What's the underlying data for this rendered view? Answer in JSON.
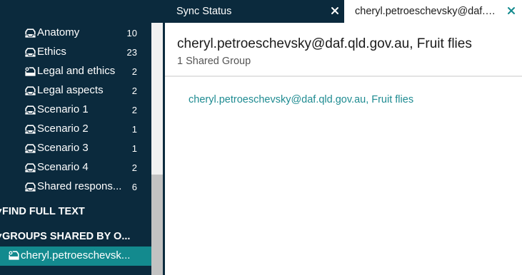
{
  "tabs": [
    {
      "label": "Sync Status"
    },
    {
      "label": "cheryl.petroeschevsky@daf.qld.gov.au, Fruit flies"
    }
  ],
  "sidebar": {
    "groups": [
      {
        "label": "Anatomy",
        "count": "10",
        "icon": "group-icon"
      },
      {
        "label": "Ethics",
        "count": "23",
        "icon": "group-icon"
      },
      {
        "label": "Legal and ethics",
        "count": "2",
        "icon": "shared-group-icon"
      },
      {
        "label": "Legal aspects",
        "count": "2",
        "icon": "group-icon"
      },
      {
        "label": "Scenario 1",
        "count": "2",
        "icon": "group-icon"
      },
      {
        "label": "Scenario 2",
        "count": "1",
        "icon": "group-icon"
      },
      {
        "label": "Scenario 3",
        "count": "1",
        "icon": "group-icon"
      },
      {
        "label": "Scenario 4",
        "count": "2",
        "icon": "group-icon"
      },
      {
        "label": "Shared respons...",
        "count": "6",
        "icon": "group-icon"
      }
    ],
    "find_full_text": "FIND FULL TEXT",
    "groups_shared_header": "GROUPS SHARED BY O...",
    "shared_item": "cheryl.petroeschevsk..."
  },
  "main": {
    "title": "cheryl.petroeschevsky@daf.qld.gov.au, Fruit flies",
    "subtitle": "1 Shared Group",
    "group_link": "cheryl.petroeschevsky@daf.qld.gov.au, Fruit flies"
  },
  "colors": {
    "sidebar_bg": "#0b2a3d",
    "accent": "#138a8e",
    "link": "#1e8b91"
  }
}
